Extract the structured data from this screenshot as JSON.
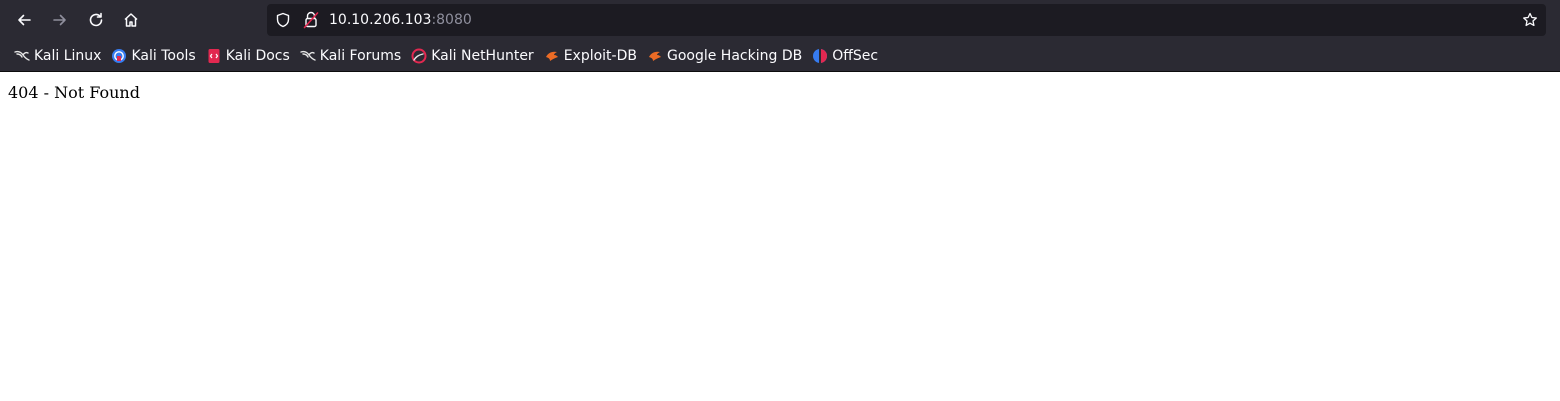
{
  "browser": {
    "url_host": "10.10.206.103",
    "url_port": ":8080",
    "icons": {
      "back": "back-arrow-icon",
      "forward": "forward-arrow-icon",
      "reload": "reload-icon",
      "home": "home-icon",
      "shield": "tracking-protection-shield-icon",
      "lock": "insecure-lock-icon",
      "star": "bookmark-star-icon"
    }
  },
  "bookmarks": [
    {
      "label": "Kali Linux",
      "icon": "kali-dragon-icon"
    },
    {
      "label": "Kali Tools",
      "icon": "kali-tools-icon"
    },
    {
      "label": "Kali Docs",
      "icon": "kali-docs-icon"
    },
    {
      "label": "Kali Forums",
      "icon": "kali-dragon-icon"
    },
    {
      "label": "Kali NetHunter",
      "icon": "nethunter-icon"
    },
    {
      "label": "Exploit-DB",
      "icon": "exploitdb-icon"
    },
    {
      "label": "Google Hacking DB",
      "icon": "exploitdb-icon"
    },
    {
      "label": "OffSec",
      "icon": "offsec-icon"
    }
  ],
  "page": {
    "message": "404 - Not Found"
  },
  "colors": {
    "toolbar_bg": "#2b2a33",
    "urlbar_bg": "#1c1b22",
    "text_light": "#fbfbfe",
    "port_gray": "#8f8f9d",
    "page_bg": "#ffffff"
  }
}
